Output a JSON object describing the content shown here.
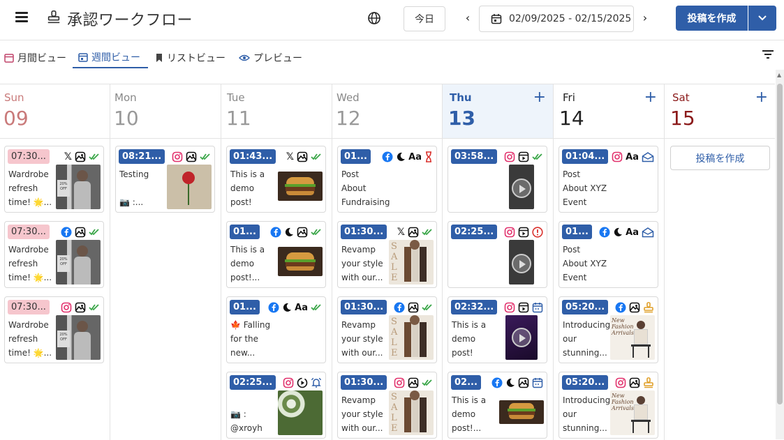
{
  "header": {
    "title": "承認ワークフロー",
    "today_label": "今日",
    "date_range": "02/09/2025 - 02/15/2025",
    "create_label": "投稿を作成",
    "prev_label": "‹",
    "next_label": "›"
  },
  "tabs": [
    {
      "label": "月間ビュー",
      "icon": "calendar-month-icon"
    },
    {
      "label": "週間ビュー",
      "icon": "calendar-week-icon",
      "active": true
    },
    {
      "label": "リストビュー",
      "icon": "bookmark-icon"
    },
    {
      "label": "プレビュー",
      "icon": "eye-icon"
    }
  ],
  "days": [
    {
      "name": "Sun",
      "num": "09"
    },
    {
      "name": "Mon",
      "num": "10"
    },
    {
      "name": "Tue",
      "num": "11"
    },
    {
      "name": "Wed",
      "num": "12"
    },
    {
      "name": "Thu",
      "num": "13"
    },
    {
      "name": "Fri",
      "num": "14"
    },
    {
      "name": "Sat",
      "num": "15"
    }
  ],
  "plus_label": "+",
  "sat_create_label": "投稿を作成",
  "posts": {
    "sun": [
      {
        "time": "07:30...",
        "l1": "Wardrobe",
        "l2": "refresh",
        "l3": "time! 🌟..."
      },
      {
        "time": "07:30...",
        "l1": "Wardrobe",
        "l2": "refresh",
        "l3": "time! 🌟..."
      },
      {
        "time": "07:30...",
        "l1": "Wardrobe",
        "l2": "refresh",
        "l3": "time! 🌟..."
      }
    ],
    "mon": [
      {
        "time": "08:21...",
        "l1": "Testing",
        "l2": "",
        "l3": "📷 :..."
      }
    ],
    "tue": [
      {
        "time": "01:43...",
        "l1": "This is a",
        "l2": "demo",
        "l3": "post!"
      },
      {
        "time": "01...",
        "l1": "This is a",
        "l2": "demo",
        "l3": "post!..."
      },
      {
        "time": "01...",
        "l1": "🍁 Falling",
        "l2": "for the",
        "l3": "new..."
      },
      {
        "time": "02:25...",
        "l1": "",
        "l2": "📷 :",
        "l3": "@xroyh"
      }
    ],
    "wed": [
      {
        "time": "01...",
        "l1": "Post",
        "l2": "About",
        "l3": "Fundraising"
      },
      {
        "time": "01:30...",
        "l1": "Revamp",
        "l2": "your style",
        "l3": "with our..."
      },
      {
        "time": "01:30...",
        "l1": "Revamp",
        "l2": "your style",
        "l3": "with our..."
      },
      {
        "time": "01:30...",
        "l1": "Revamp",
        "l2": "your style",
        "l3": "with our..."
      }
    ],
    "thu": [
      {
        "time": "03:58..."
      },
      {
        "time": "02:25..."
      },
      {
        "time": "02:32...",
        "l1": "This is a",
        "l2": "demo",
        "l3": "post!"
      },
      {
        "time": "02...",
        "l1": "This is a",
        "l2": "demo",
        "l3": "post!..."
      }
    ],
    "fri": [
      {
        "time": "01:04...",
        "l1": "Post",
        "l2": "About XYZ",
        "l3": "Event"
      },
      {
        "time": "01...",
        "l1": "Post",
        "l2": "About XYZ",
        "l3": "Event"
      },
      {
        "time": "05:20...",
        "l1": "Introducing",
        "l2": "our",
        "l3": "stunning..."
      },
      {
        "time": "05:20...",
        "l1": "Introducing",
        "l2": "our",
        "l3": "stunning..."
      }
    ]
  },
  "thumb_texts": {
    "sale": "SALE",
    "pct": "20% OFF",
    "fashion": "New Fashion Arrivals",
    "aa": "Aa"
  },
  "colors": {
    "accent": "#2f5ea8",
    "pink_badge": "#f6c6cd",
    "check": "#3aa648",
    "instagram": "#e1306c",
    "facebook": "#1877f2"
  }
}
